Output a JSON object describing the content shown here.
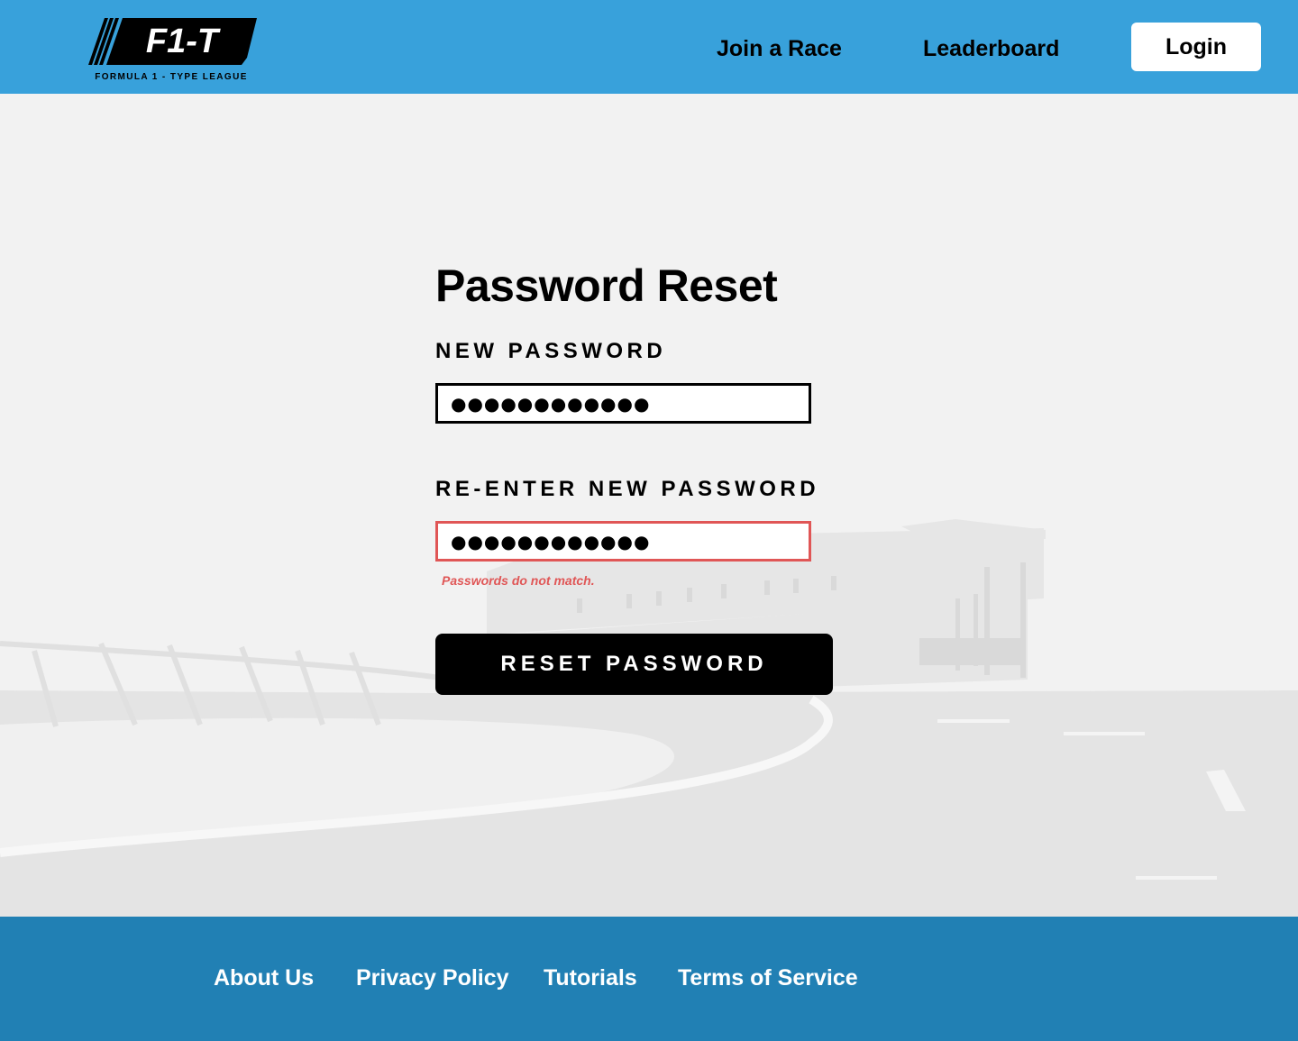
{
  "header": {
    "logo": {
      "text": "F1-T",
      "tagline": "FORMULA 1 - TYPE LEAGUE"
    },
    "nav": {
      "join_race": "Join a Race",
      "leaderboard": "Leaderboard"
    },
    "login_label": "Login"
  },
  "form": {
    "title": "Password Reset",
    "new_password_label": "NEW PASSWORD",
    "new_password_value": "●●●●●●●●●●●●",
    "reenter_label": "RE-ENTER NEW PASSWORD",
    "reenter_value": "●●●●●●●●●●●●",
    "error": "Passwords do not match.",
    "submit_label": "RESET PASSWORD"
  },
  "footer": {
    "links": [
      "About Us",
      "Privacy Policy",
      "Tutorials",
      "Terms of Service"
    ]
  },
  "colors": {
    "header_bg": "#38a1db",
    "footer_bg": "#2180b4",
    "page_bg": "#f2f2f2",
    "error": "#e05656",
    "button_bg": "#000000"
  },
  "icons": [
    "logo-speed-stripes-icon"
  ]
}
